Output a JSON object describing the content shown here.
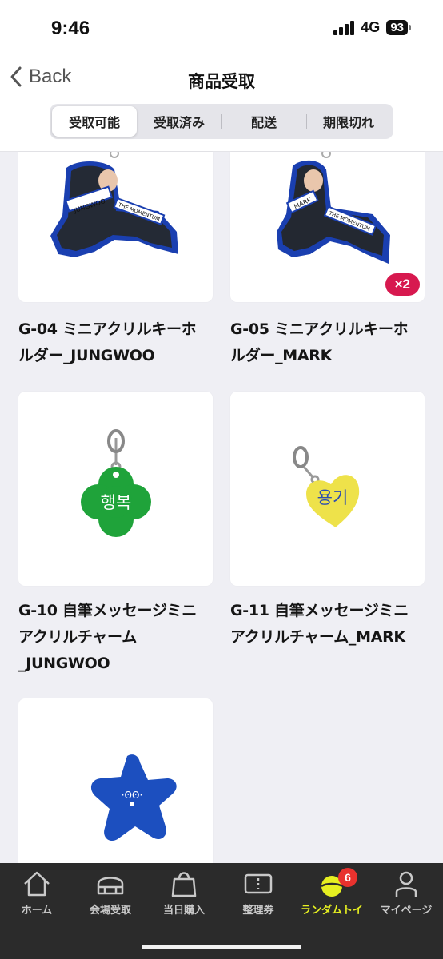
{
  "status": {
    "time": "9:46",
    "network": "4G",
    "battery": "93"
  },
  "nav": {
    "back_label": "Back",
    "title": "商品受取"
  },
  "segments": [
    {
      "label": "受取可能",
      "active": true
    },
    {
      "label": "受取済み",
      "active": false
    },
    {
      "label": "配送",
      "active": false
    },
    {
      "label": "期限切れ",
      "active": false
    }
  ],
  "items": [
    {
      "name": "G-04 ミニアクリルキーホルダー_JUNGWOO",
      "line1": "G-04 ミニアクリルキーホ",
      "line2": "ルダー_JUNGWOO",
      "image": "acrylic-keyholder-jungwoo",
      "printed_name": "JUNGWOO",
      "printed_tag": "THE MOMENTUM"
    },
    {
      "name": "G-05 ミニアクリルキーホルダー_MARK",
      "line1": "G-05 ミニアクリルキーホ",
      "line2": "ルダー_MARK",
      "image": "acrylic-keyholder-mark",
      "printed_name": "MARK",
      "printed_tag": "THE MOMENTUM",
      "quantity": "×2"
    },
    {
      "name": "G-10 自筆メッセージミニアクリルチャーム_JUNGWOO",
      "line1": "G-10 自筆メッセージミニ",
      "line2": "アクリルチャーム",
      "line3": "_JUNGWOO",
      "image": "green-clover-charm",
      "charm_text": "행복",
      "color": "#1fa33a"
    },
    {
      "name": "G-11 自筆メッセージミニアクリルチャーム_MARK",
      "line1": "G-11 自筆メッセージミニ",
      "line2": "アクリルチャーム_MARK",
      "image": "yellow-heart-charm",
      "charm_text": "용기",
      "color": "#eee24a"
    },
    {
      "name": "",
      "image": "blue-star-charm",
      "color": "#1c4fbf"
    }
  ],
  "tabbar": [
    {
      "label": "ホーム",
      "icon": "home-icon"
    },
    {
      "label": "会場受取",
      "icon": "venue-icon"
    },
    {
      "label": "当日購入",
      "icon": "shopping-bag-icon"
    },
    {
      "label": "整理券",
      "icon": "ticket-icon"
    },
    {
      "label": "ランダムトイ",
      "icon": "random-toy-icon",
      "active": true,
      "badge": "6"
    },
    {
      "label": "マイページ",
      "icon": "person-icon"
    }
  ],
  "colors": {
    "accent": "#e6ef21",
    "badge": "#e8322e",
    "qty_badge": "#d7194f",
    "tabbar_bg": "#2b2b2b"
  }
}
